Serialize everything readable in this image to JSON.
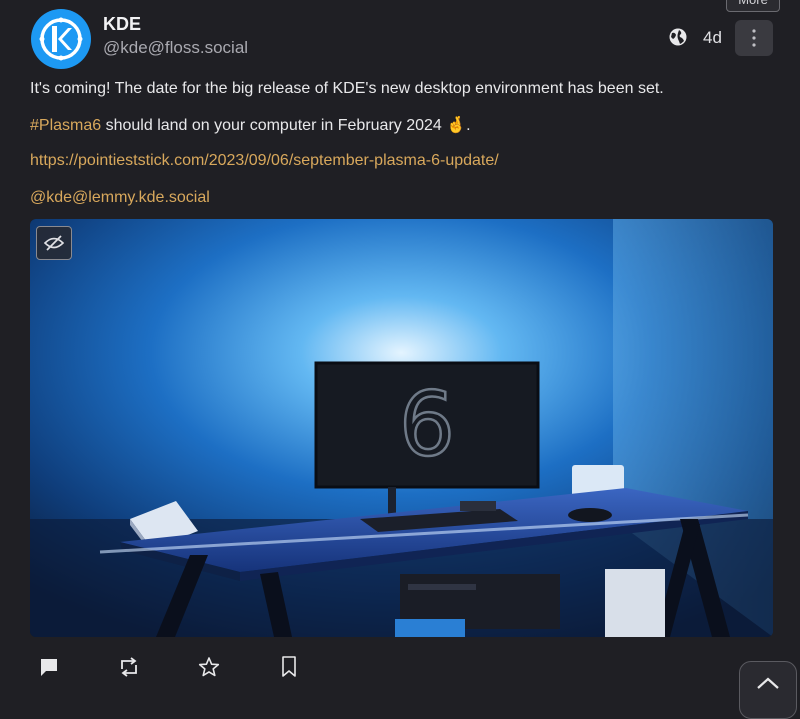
{
  "tooltip": {
    "text": "More"
  },
  "post": {
    "display_name": "KDE",
    "handle": "@kde@floss.social",
    "time": "4d",
    "visibility_icon": "globe-icon",
    "content": {
      "line1": "It's coming! The date for the big release of KDE's new desktop environment has been set.",
      "hashtag": "#Plasma6",
      "line2_rest": " should land on your computer in February 2024 🤞.",
      "url": "https://pointieststick.com/2023/09/06/september-plasma-6-update/",
      "mention": "@kde@lemmy.kde.social"
    },
    "media": {
      "screen_text": "6",
      "hide_icon": "eye-slash-icon"
    }
  },
  "actions": {
    "reply_icon": "reply-icon",
    "boost_icon": "boost-icon",
    "favourite_icon": "star-icon",
    "bookmark_icon": "bookmark-icon"
  },
  "colors": {
    "accent_link": "#d8a85c",
    "kde_blue": "#1d99f3",
    "background": "#1f1f24"
  }
}
